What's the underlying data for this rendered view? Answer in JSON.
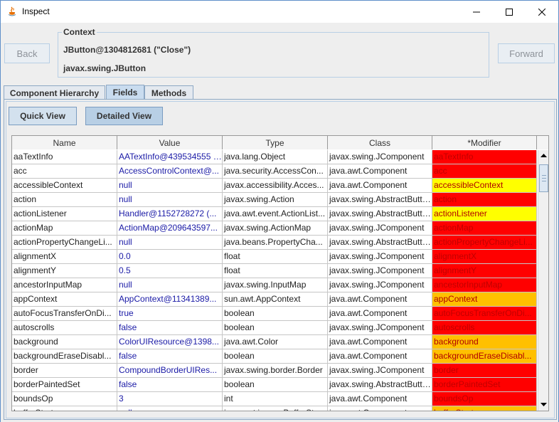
{
  "window": {
    "title": "Inspect"
  },
  "toolbar": {
    "back_label": "Back",
    "forward_label": "Forward"
  },
  "context": {
    "legend": "Context",
    "object": "JButton@1304812681 (\"Close\")",
    "class_name": "javax.swing.JButton"
  },
  "tabs": [
    {
      "label": "Component Hierarchy",
      "active": false
    },
    {
      "label": "Fields",
      "active": true
    },
    {
      "label": "Methods",
      "active": false
    }
  ],
  "view_buttons": {
    "quick": "Quick View",
    "detailed": "Detailed View"
  },
  "table": {
    "columns": [
      "Name",
      "Value",
      "Type",
      "Class",
      "*Modifier"
    ],
    "rows": [
      {
        "name": "aaTextInfo",
        "value": "AATextInfo@439534555 (...",
        "type": "java.lang.Object",
        "class": "javax.swing.JComponent",
        "modifier": "aaTextInfo",
        "modifier_color": "red"
      },
      {
        "name": "acc",
        "value": "AccessControlContext@...",
        "type": "java.security.AccessCon...",
        "class": "java.awt.Component",
        "modifier": "acc",
        "modifier_color": "red"
      },
      {
        "name": "accessibleContext",
        "value": "null",
        "type": "javax.accessibility.Acces...",
        "class": "java.awt.Component",
        "modifier": "accessibleContext",
        "modifier_color": "yellow"
      },
      {
        "name": "action",
        "value": "null",
        "type": "javax.swing.Action",
        "class": "javax.swing.AbstractButton",
        "modifier": "action",
        "modifier_color": "red"
      },
      {
        "name": "actionListener",
        "value": "Handler@1152728272 (...",
        "type": "java.awt.event.ActionList...",
        "class": "javax.swing.AbstractButton",
        "modifier": "actionListener",
        "modifier_color": "yellow"
      },
      {
        "name": "actionMap",
        "value": "ActionMap@209643597...",
        "type": "javax.swing.ActionMap",
        "class": "javax.swing.JComponent",
        "modifier": "actionMap",
        "modifier_color": "red"
      },
      {
        "name": "actionPropertyChangeLi...",
        "value": "null",
        "type": "java.beans.PropertyCha...",
        "class": "javax.swing.AbstractButton",
        "modifier": "actionPropertyChangeLi...",
        "modifier_color": "red"
      },
      {
        "name": "alignmentX",
        "value": "0.0",
        "type": "float",
        "class": "javax.swing.JComponent",
        "modifier": "alignmentX",
        "modifier_color": "red"
      },
      {
        "name": "alignmentY",
        "value": "0.5",
        "type": "float",
        "class": "javax.swing.JComponent",
        "modifier": "alignmentY",
        "modifier_color": "red"
      },
      {
        "name": "ancestorInputMap",
        "value": "null",
        "type": "javax.swing.InputMap",
        "class": "javax.swing.JComponent",
        "modifier": "ancestorInputMap",
        "modifier_color": "red"
      },
      {
        "name": "appContext",
        "value": "AppContext@11341389...",
        "type": "sun.awt.AppContext",
        "class": "java.awt.Component",
        "modifier": "appContext",
        "modifier_color": "orange"
      },
      {
        "name": "autoFocusTransferOnDi...",
        "value": "true",
        "type": "boolean",
        "class": "java.awt.Component",
        "modifier": "autoFocusTransferOnDi...",
        "modifier_color": "red"
      },
      {
        "name": "autoscrolls",
        "value": "false",
        "type": "boolean",
        "class": "javax.swing.JComponent",
        "modifier": "autoscrolls",
        "modifier_color": "red"
      },
      {
        "name": "background",
        "value": "ColorUIResource@1398...",
        "type": "java.awt.Color",
        "class": "java.awt.Component",
        "modifier": "background",
        "modifier_color": "orange"
      },
      {
        "name": "backgroundEraseDisabl...",
        "value": "false",
        "type": "boolean",
        "class": "java.awt.Component",
        "modifier": "backgroundEraseDisabl...",
        "modifier_color": "orange"
      },
      {
        "name": "border",
        "value": "CompoundBorderUIRes...",
        "type": "javax.swing.border.Border",
        "class": "javax.swing.JComponent",
        "modifier": "border",
        "modifier_color": "red"
      },
      {
        "name": "borderPaintedSet",
        "value": "false",
        "type": "boolean",
        "class": "javax.swing.AbstractButton",
        "modifier": "borderPaintedSet",
        "modifier_color": "red"
      },
      {
        "name": "boundsOp",
        "value": "3",
        "type": "int",
        "class": "java.awt.Component",
        "modifier": "boundsOp",
        "modifier_color": "red"
      },
      {
        "name": "bufferStrategy",
        "value": "null",
        "type": "java.awt.image.BufferStr...",
        "class": "java.awt.Component",
        "modifier": "bufferStrategy",
        "modifier_color": "orange"
      }
    ]
  },
  "colors": {
    "red": "#ff0000",
    "yellow": "#ffff00",
    "orange": "#ffc000"
  }
}
